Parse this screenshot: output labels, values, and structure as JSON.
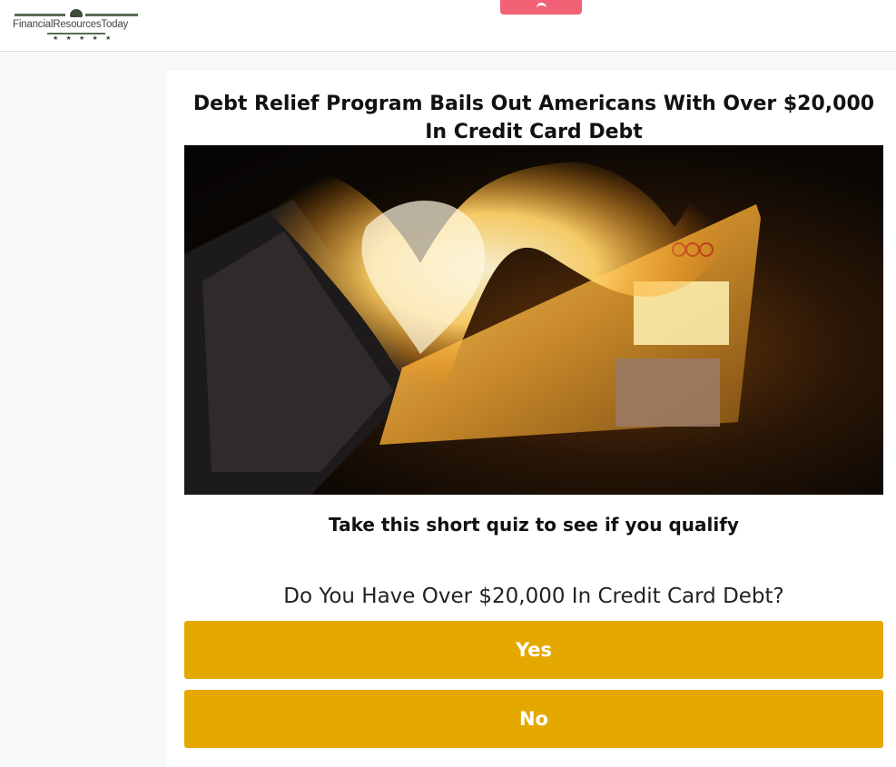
{
  "header": {
    "logo_text": "FinancialResourcesToday",
    "logo_stars": "★ ★ ★ ★ ★"
  },
  "article": {
    "headline": "Debt Relief Program Bails Out Americans With Over $20,000 In Credit Card Debt",
    "hero_image_icon": "burning-credit-card-photo",
    "quiz_intro": "Take this short quiz to see if you qualify"
  },
  "quiz": {
    "question": "Do You Have Over $20,000 In Credit Card Debt?",
    "options": [
      "Yes",
      "No"
    ]
  },
  "colors": {
    "button": "#e5a800",
    "top_tab": "#f26176",
    "page_background": "#f7f8fa"
  }
}
